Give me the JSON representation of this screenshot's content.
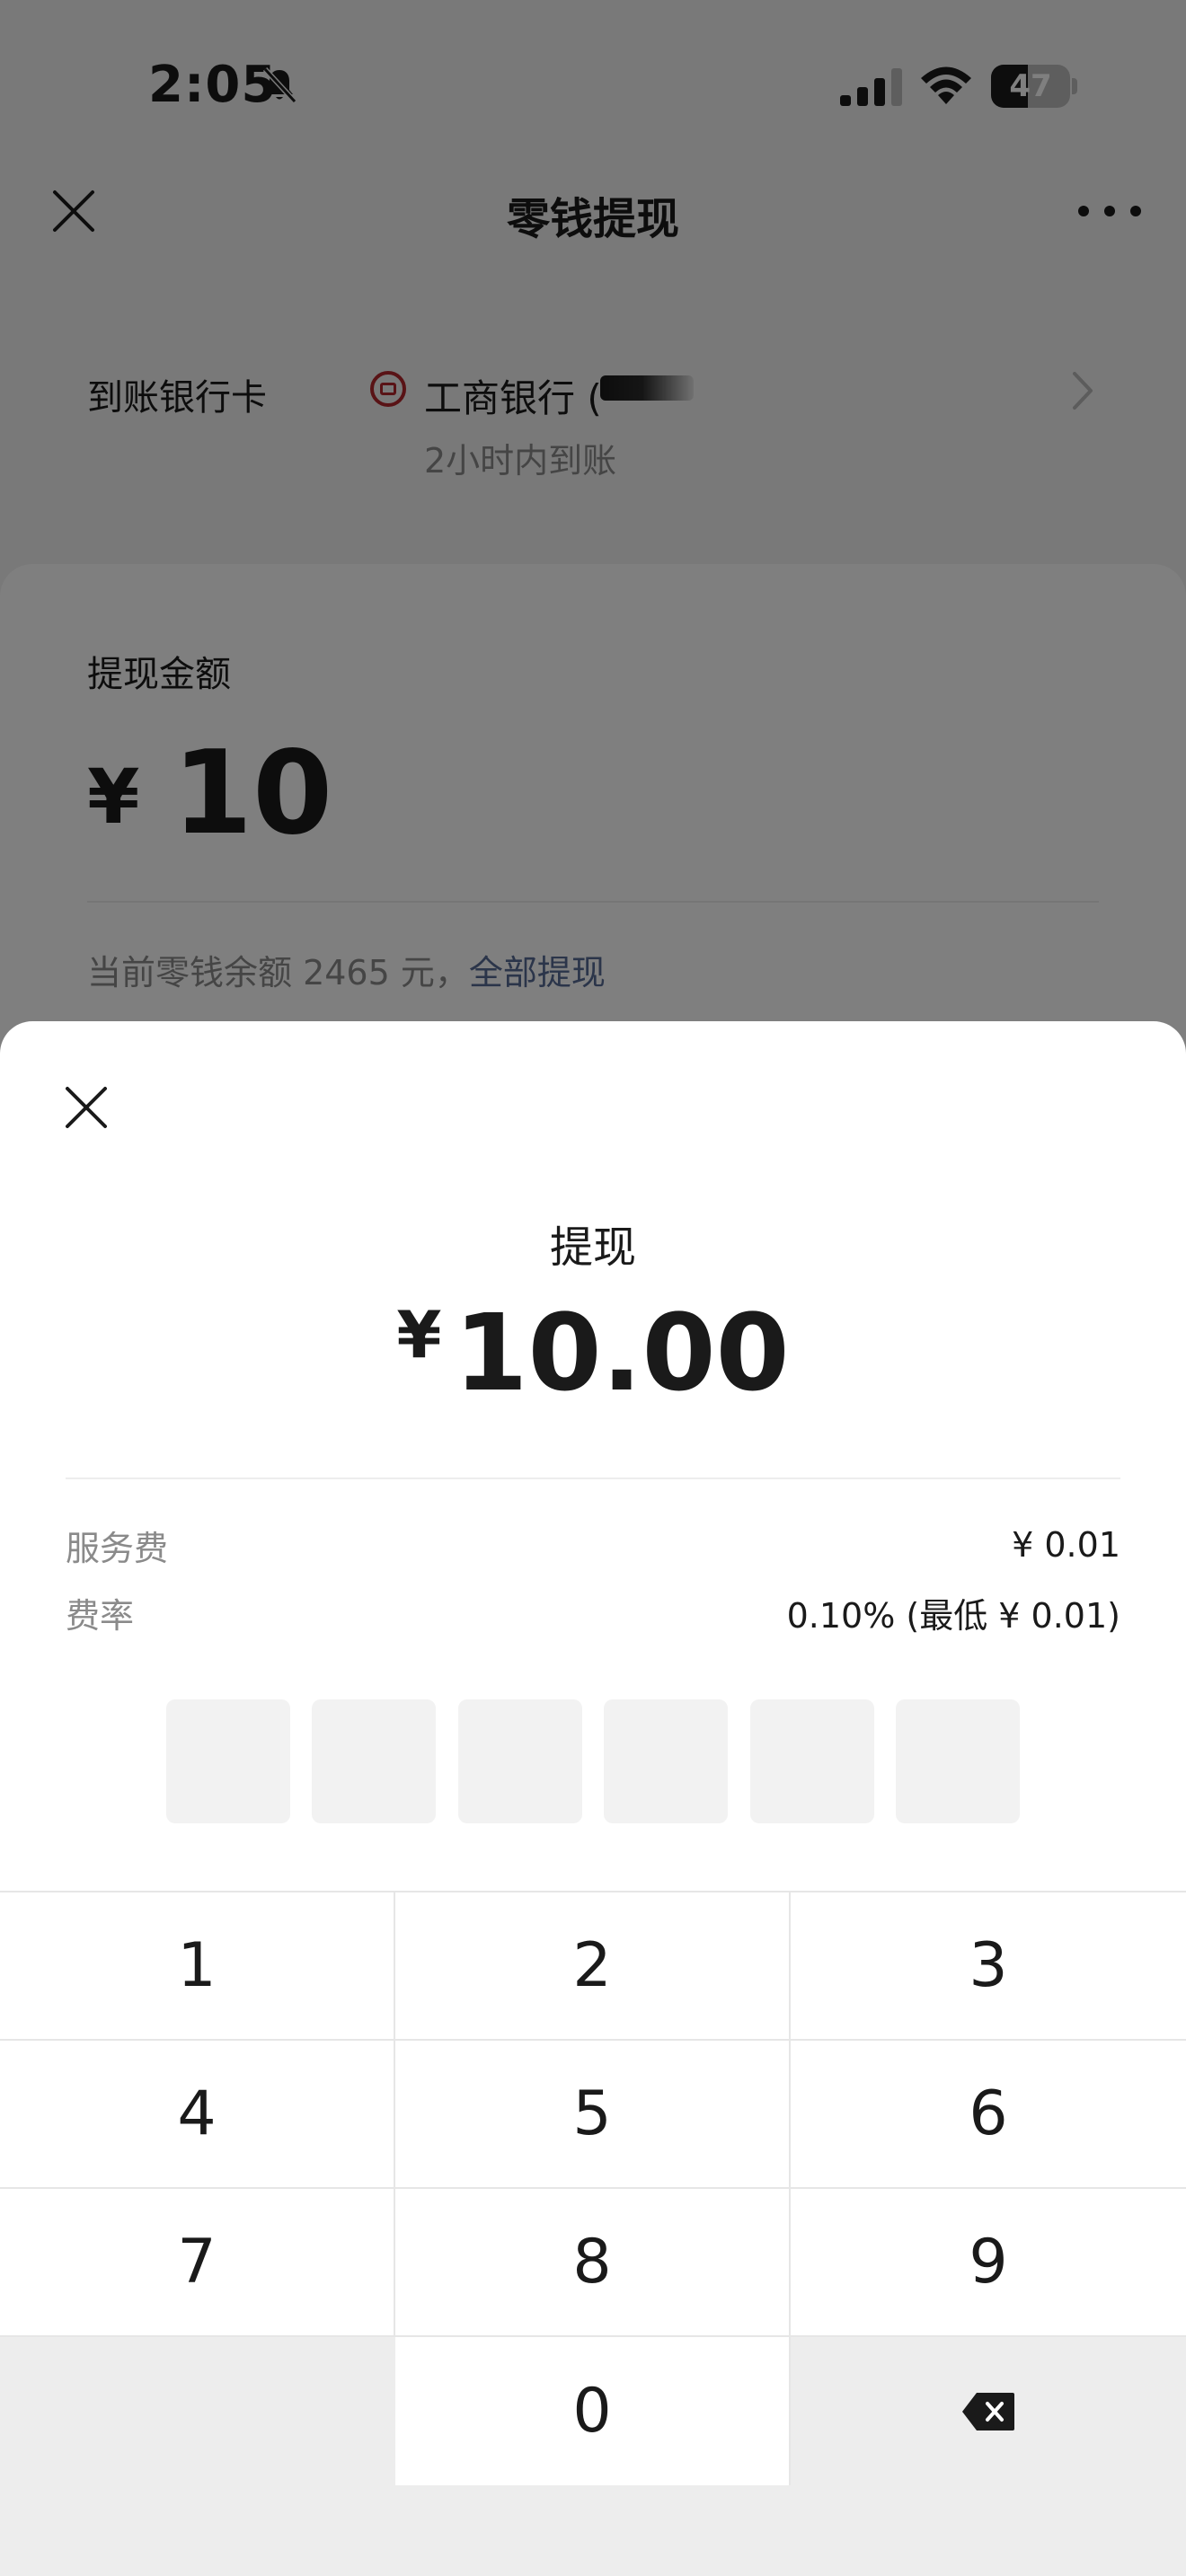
{
  "status_bar": {
    "time": "2:05",
    "battery_level": "47",
    "battery_fraction": 0.47
  },
  "nav": {
    "title": "零钱提现",
    "close_icon": "close-icon",
    "more_icon": "more-dots-icon"
  },
  "bank": {
    "label": "到账银行卡",
    "name": "工商银行 (",
    "arrival_text": "2小时内到账",
    "logo_color": "#b3262d",
    "chevron_icon": "chevron-right-icon"
  },
  "amount_card": {
    "label": "提现金额",
    "currency": "¥",
    "value": "10",
    "balance_text": "当前零钱余额 2465 元，",
    "withdraw_all_label": "全部提现",
    "link_color": "#576b95"
  },
  "sheet": {
    "close_icon": "close-icon",
    "title": "提现",
    "currency": "¥",
    "amount": "10.00",
    "fee_rows": [
      {
        "label": "服务费",
        "value": "¥ 0.01"
      },
      {
        "label": "费率",
        "value": "0.10% (最低 ¥ 0.01)"
      }
    ],
    "pin_length": 6
  },
  "keypad": {
    "keys": [
      "1",
      "2",
      "3",
      "4",
      "5",
      "6",
      "7",
      "8",
      "9",
      "",
      "0",
      "⌫"
    ],
    "backspace_icon": "backspace-icon"
  }
}
